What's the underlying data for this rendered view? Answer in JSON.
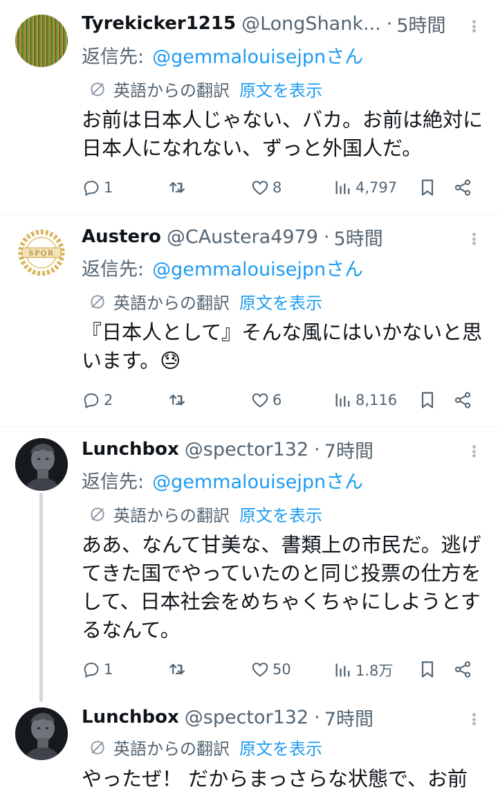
{
  "tweets": [
    {
      "display_name": "Tyrekicker1215",
      "handle": "@LongShank...",
      "separator": "·",
      "time": "5時間",
      "reply_label": "返信先:",
      "reply_to": "@gemmalouisejpnさん",
      "translated_label": "英語からの翻訳",
      "show_original_label": "原文を表示",
      "text": "お前は日本人じゃない、バカ。お前は絶対に日本人になれない、ずっと外国人だ。",
      "replies": "1",
      "retweets": "",
      "likes": "8",
      "views": "4,797"
    },
    {
      "display_name": "Austero",
      "handle": "@CAustera4979",
      "separator": "·",
      "time": "5時間",
      "reply_label": "返信先:",
      "reply_to": "@gemmalouisejpnさん",
      "translated_label": "英語からの翻訳",
      "show_original_label": "原文を表示",
      "text": "『日本人として』そんな風にはいかないと思います。😓",
      "replies": "2",
      "retweets": "",
      "likes": "6",
      "views": "8,116"
    },
    {
      "display_name": "Lunchbox",
      "handle": "@spector132",
      "separator": "·",
      "time": "7時間",
      "reply_label": "返信先:",
      "reply_to": "@gemmalouisejpnさん",
      "translated_label": "英語からの翻訳",
      "show_original_label": "原文を表示",
      "text": "ああ、なんて甘美な、書類上の市民だ。逃げてきた国でやっていたのと同じ投票の仕方をして、日本社会をめちゃくちゃにしようとするなんて。",
      "replies": "1",
      "retweets": "",
      "likes": "50",
      "views": "1.8万"
    },
    {
      "display_name": "Lunchbox",
      "handle": "@spector132",
      "separator": "·",
      "time": "7時間",
      "translated_label": "英語からの翻訳",
      "show_original_label": "原文を表示",
      "text": "やったぜ！ だからまっさらな状態で、お前"
    }
  ],
  "avatar_spqr_text": "SPQR",
  "colors": {
    "link": "#1d9bf0",
    "muted": "#536471",
    "text": "#0f1419",
    "thread_line": "#cfd9de"
  }
}
